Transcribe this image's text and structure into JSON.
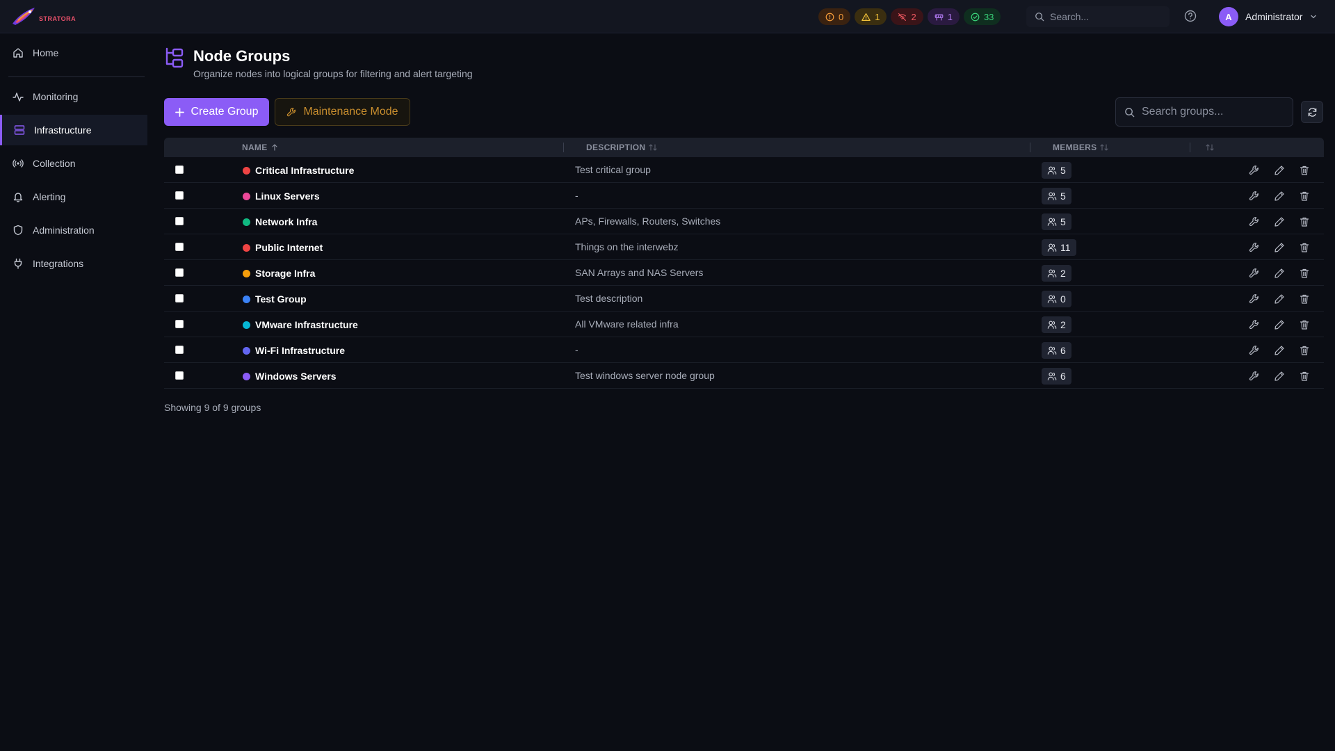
{
  "app": {
    "logo_text": "STRATORA"
  },
  "topbar": {
    "status": [
      {
        "key": "critical",
        "count": "0"
      },
      {
        "key": "warning",
        "count": "1"
      },
      {
        "key": "down",
        "count": "2"
      },
      {
        "key": "maintenance",
        "count": "1"
      },
      {
        "key": "up",
        "count": "33"
      }
    ],
    "search_placeholder": "Search...",
    "user_initial": "A",
    "user_name": "Administrator"
  },
  "sidebar": {
    "items": [
      {
        "label": "Home",
        "icon": "home-icon"
      },
      {
        "label": "Monitoring",
        "icon": "activity-icon"
      },
      {
        "label": "Infrastructure",
        "icon": "server-icon",
        "active": true
      },
      {
        "label": "Collection",
        "icon": "broadcast-icon"
      },
      {
        "label": "Alerting",
        "icon": "bell-icon"
      },
      {
        "label": "Administration",
        "icon": "shield-icon"
      },
      {
        "label": "Integrations",
        "icon": "plug-icon"
      }
    ]
  },
  "page": {
    "title": "Node Groups",
    "subtitle": "Organize nodes into logical groups for filtering and alert targeting"
  },
  "toolbar": {
    "create_label": "Create Group",
    "maintenance_label": "Maintenance Mode",
    "search_placeholder": "Search groups..."
  },
  "table": {
    "columns": [
      "NAME",
      "DESCRIPTION",
      "MEMBERS"
    ],
    "rows": [
      {
        "name": "Critical Infrastructure",
        "description": "Test critical group",
        "members": "5",
        "color": "#ef4444"
      },
      {
        "name": "Linux Servers",
        "description": "-",
        "members": "5",
        "color": "#ec4899"
      },
      {
        "name": "Network Infra",
        "description": "APs, Firewalls, Routers, Switches",
        "members": "5",
        "color": "#10b981"
      },
      {
        "name": "Public Internet",
        "description": "Things on the interwebz",
        "members": "11",
        "color": "#ef4444"
      },
      {
        "name": "Storage Infra",
        "description": "SAN Arrays and NAS Servers",
        "members": "2",
        "color": "#f59e0b"
      },
      {
        "name": "Test Group",
        "description": "Test description",
        "members": "0",
        "color": "#3b82f6"
      },
      {
        "name": "VMware Infrastructure",
        "description": "All VMware related infra",
        "members": "2",
        "color": "#06b6d4"
      },
      {
        "name": "Wi-Fi Infrastructure",
        "description": "-",
        "members": "6",
        "color": "#6366f1"
      },
      {
        "name": "Windows Servers",
        "description": "Test windows server node group",
        "members": "6",
        "color": "#8b5cf6"
      }
    ]
  },
  "footer": {
    "showing": "Showing 9 of 9 groups"
  },
  "colors": {
    "accent": "#8b5cf6",
    "background": "#0b0d14",
    "topbar": "#131620"
  }
}
